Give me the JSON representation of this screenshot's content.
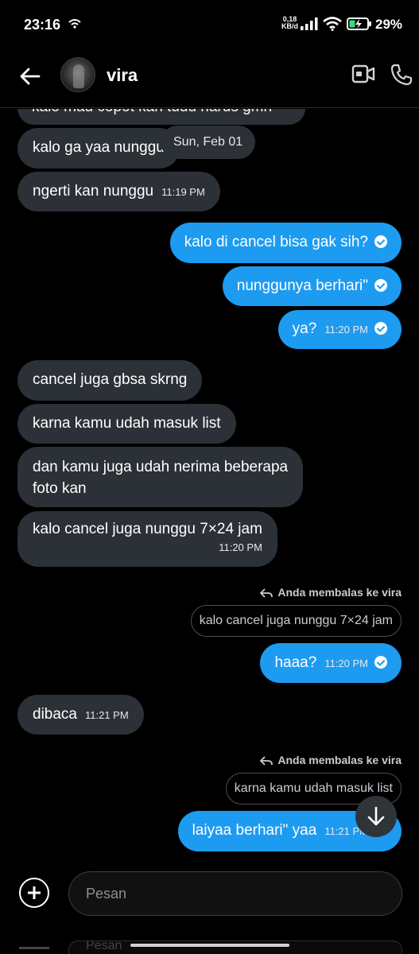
{
  "status_bar": {
    "time": "23:16",
    "net_speed_value": "0,18",
    "net_speed_unit": "KB/d",
    "battery_pct": "29%"
  },
  "header": {
    "contact_name": "vira"
  },
  "chat": {
    "date_separator": "Sun, Feb 01",
    "messages": [
      {
        "dir": "in",
        "text": "kalo mau copot kan tuuu harus gmn",
        "time": ""
      },
      {
        "dir": "in",
        "text": "kalo ga yaa nunggu",
        "time": ""
      },
      {
        "dir": "in",
        "text": "ngerti kan nunggu",
        "time": "11:19 PM"
      },
      {
        "dir": "out",
        "text": "kalo di cancel bisa gak sih?",
        "time": ""
      },
      {
        "dir": "out",
        "text": "nunggunya berhari\"",
        "time": ""
      },
      {
        "dir": "out",
        "text": "ya?",
        "time": "11:20 PM"
      },
      {
        "dir": "in",
        "text": "cancel juga gbsa skrng",
        "time": ""
      },
      {
        "dir": "in",
        "text": "karna kamu udah masuk list",
        "time": ""
      },
      {
        "dir": "in",
        "text_line1": "dan kamu juga udah nerima beberapa",
        "text_line2": "foto kan",
        "time": ""
      },
      {
        "dir": "in",
        "text": "kalo cancel juga nunggu 7×24 jam",
        "time": "11:20 PM"
      },
      {
        "dir": "out",
        "reply_label": "Anda membalas ke vira",
        "quote": "kalo cancel juga nunggu 7×24 jam",
        "text": "haaa?",
        "time": "11:20 PM"
      },
      {
        "dir": "in",
        "text": "dibaca",
        "time": "11:21 PM"
      },
      {
        "dir": "out",
        "reply_label": "Anda membalas ke vira",
        "quote": "karna kamu udah masuk list",
        "text": "laiyaa berhari\" yaa",
        "time": "11:21 PM"
      }
    ]
  },
  "composer": {
    "placeholder": "Pesan",
    "ghost_placeholder": "Pesan"
  },
  "colors": {
    "background": "#000000",
    "incoming_bubble": "#2b3136",
    "outgoing_bubble": "#1d9bf0"
  }
}
